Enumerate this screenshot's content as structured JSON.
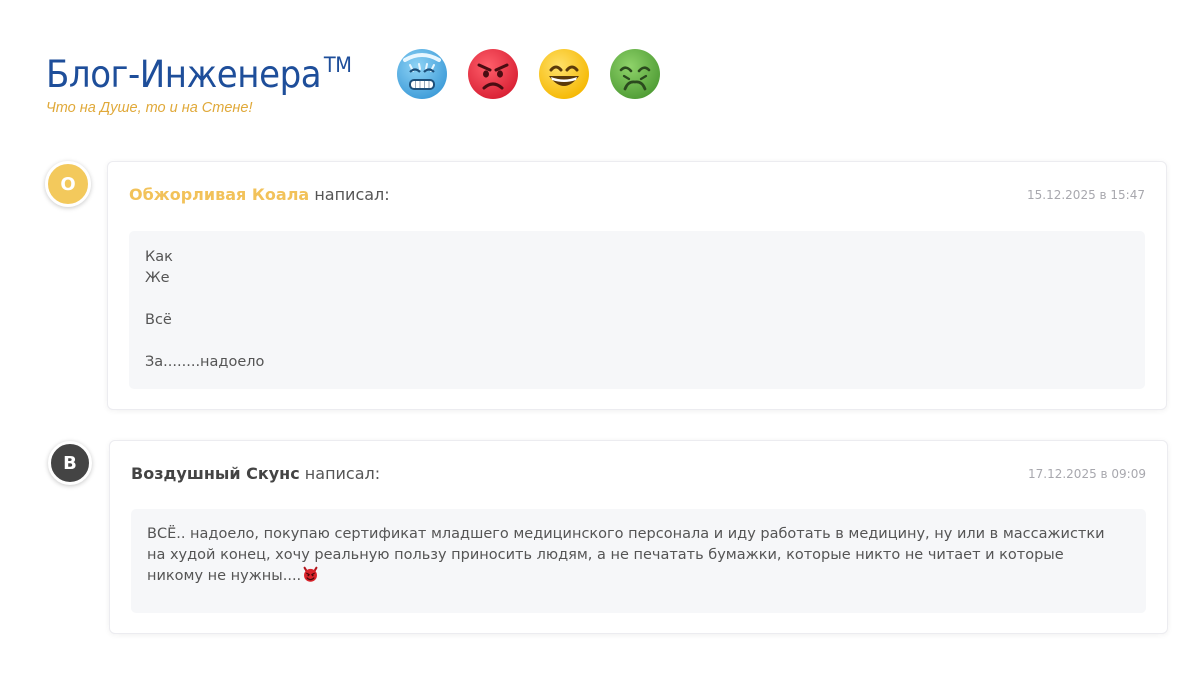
{
  "site": {
    "title": "Блог-Инженера",
    "trademark": "TM",
    "tagline": "Что на Душе, то и на Стене!",
    "reactions": [
      "cold-face-emoji",
      "angry-face-emoji",
      "grinning-face-emoji",
      "nauseated-face-emoji"
    ]
  },
  "comments": [
    {
      "avatar_letter": "О",
      "avatar_color": "#f3c95c",
      "author": "Обжорливая Коала",
      "author_color": "#f2c25a",
      "action": "написал:",
      "date": "15.12.2025 в 15:47",
      "lines": [
        "Как",
        "Же",
        "",
        "Всё",
        "",
        "За........надоело"
      ]
    },
    {
      "avatar_letter": "В",
      "avatar_color": "#444444",
      "author": "Воздушный Скунс",
      "author_color": "#444444",
      "action": "написал:",
      "date": "17.12.2025 в 09:09",
      "text": "ВСЁ.. надоело, покупаю сертификат младшего медицинского персонала и иду работать в медицину, ну или в массажистки на худой конец, хочу реальную пользу приносить людям, а не печатать бумажки, которые никто не читает и которые никому не нужны....",
      "trailing_icon": "smiling-devil-emoji"
    }
  ]
}
